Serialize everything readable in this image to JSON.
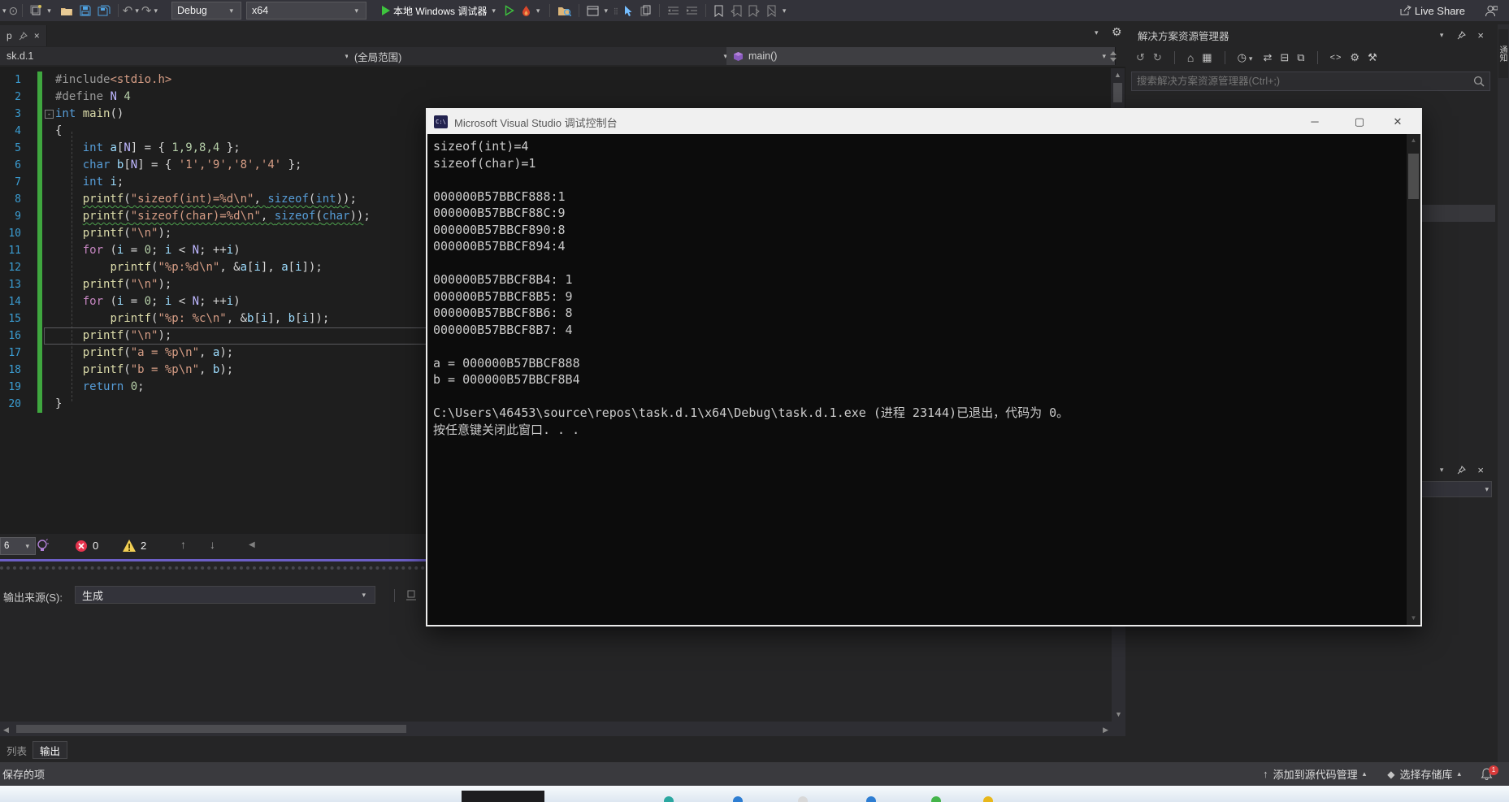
{
  "toolbar": {
    "debug_config": "Debug",
    "platform": "x64",
    "start_label": "本地 Windows 调试器",
    "live_share_label": "Live Share",
    "start_color": "#3EC43E",
    "accent_purple": "#6C5FC7"
  },
  "doc_tab": {
    "label": "p"
  },
  "navbar": {
    "file": "sk.d.1",
    "scope": "(全局范围)",
    "symbol": "main()"
  },
  "editor": {
    "lines": [
      {
        "n": 1,
        "segs": [
          {
            "c": "pp",
            "t": "#include"
          },
          {
            "c": "s2",
            "t": "<stdio.h>"
          }
        ]
      },
      {
        "n": 2,
        "segs": [
          {
            "c": "pp",
            "t": "#define "
          },
          {
            "c": "m",
            "t": "N"
          },
          {
            "c": "p",
            "t": " "
          },
          {
            "c": "n",
            "t": "4"
          }
        ]
      },
      {
        "n": 3,
        "fold": true,
        "segs": [
          {
            "c": "k",
            "t": "int"
          },
          {
            "c": "p",
            "t": " "
          },
          {
            "c": "f",
            "t": "main"
          },
          {
            "c": "p",
            "t": "()"
          }
        ]
      },
      {
        "n": 4,
        "segs": [
          {
            "c": "p",
            "t": "{"
          }
        ]
      },
      {
        "n": 5,
        "segs": [
          {
            "c": "p",
            "t": "    "
          },
          {
            "c": "k",
            "t": "int"
          },
          {
            "c": "p",
            "t": " "
          },
          {
            "c": "v",
            "t": "a"
          },
          {
            "c": "p",
            "t": "["
          },
          {
            "c": "m",
            "t": "N"
          },
          {
            "c": "p",
            "t": "] = { "
          },
          {
            "c": "n",
            "t": "1,9,8,4"
          },
          {
            "c": "p",
            "t": " };"
          }
        ]
      },
      {
        "n": 6,
        "segs": [
          {
            "c": "p",
            "t": "    "
          },
          {
            "c": "k",
            "t": "char"
          },
          {
            "c": "p",
            "t": " "
          },
          {
            "c": "v",
            "t": "b"
          },
          {
            "c": "p",
            "t": "["
          },
          {
            "c": "m",
            "t": "N"
          },
          {
            "c": "p",
            "t": "] = { "
          },
          {
            "c": "s",
            "t": "'1','9','8','4'"
          },
          {
            "c": "p",
            "t": " };"
          }
        ]
      },
      {
        "n": 7,
        "segs": [
          {
            "c": "p",
            "t": "    "
          },
          {
            "c": "k",
            "t": "int"
          },
          {
            "c": "p",
            "t": " "
          },
          {
            "c": "v",
            "t": "i"
          },
          {
            "c": "p",
            "t": ";"
          }
        ]
      },
      {
        "n": 8,
        "segs": [
          {
            "c": "p",
            "t": "    "
          },
          {
            "c": "f",
            "t": "printf",
            "u": 1
          },
          {
            "c": "p",
            "t": "(",
            "u": 1
          },
          {
            "c": "s",
            "t": "\"sizeof(int)=%d\\n\"",
            "u": 1
          },
          {
            "c": "p",
            "t": ", ",
            "u": 1
          },
          {
            "c": "k",
            "t": "sizeof",
            "u": 1
          },
          {
            "c": "p",
            "t": "(",
            "u": 1
          },
          {
            "c": "k",
            "t": "int",
            "u": 1
          },
          {
            "c": "p",
            "t": "))",
            "u": 1
          },
          {
            "c": "p",
            "t": ";"
          }
        ]
      },
      {
        "n": 9,
        "segs": [
          {
            "c": "p",
            "t": "    "
          },
          {
            "c": "f",
            "t": "printf",
            "u": 1
          },
          {
            "c": "p",
            "t": "(",
            "u": 1
          },
          {
            "c": "s",
            "t": "\"sizeof(char)=%d\\n\"",
            "u": 1
          },
          {
            "c": "p",
            "t": ", ",
            "u": 1
          },
          {
            "c": "k",
            "t": "sizeof",
            "u": 1
          },
          {
            "c": "p",
            "t": "(",
            "u": 1
          },
          {
            "c": "k",
            "t": "char",
            "u": 1
          },
          {
            "c": "p",
            "t": "))",
            "u": 1
          },
          {
            "c": "p",
            "t": ";"
          }
        ]
      },
      {
        "n": 10,
        "segs": [
          {
            "c": "p",
            "t": "    "
          },
          {
            "c": "f",
            "t": "printf"
          },
          {
            "c": "p",
            "t": "("
          },
          {
            "c": "s",
            "t": "\"\\n\""
          },
          {
            "c": "p",
            "t": ");"
          }
        ]
      },
      {
        "n": 11,
        "segs": [
          {
            "c": "p",
            "t": "    "
          },
          {
            "c": "c",
            "t": "for"
          },
          {
            "c": "p",
            "t": " ("
          },
          {
            "c": "v",
            "t": "i"
          },
          {
            "c": "p",
            "t": " = "
          },
          {
            "c": "n",
            "t": "0"
          },
          {
            "c": "p",
            "t": "; "
          },
          {
            "c": "v",
            "t": "i"
          },
          {
            "c": "p",
            "t": " < "
          },
          {
            "c": "m",
            "t": "N"
          },
          {
            "c": "p",
            "t": "; ++"
          },
          {
            "c": "v",
            "t": "i"
          },
          {
            "c": "p",
            "t": ")"
          }
        ]
      },
      {
        "n": 12,
        "segs": [
          {
            "c": "p",
            "t": "        "
          },
          {
            "c": "f",
            "t": "printf"
          },
          {
            "c": "p",
            "t": "("
          },
          {
            "c": "s",
            "t": "\"%p:%d\\n\""
          },
          {
            "c": "p",
            "t": ", &"
          },
          {
            "c": "v",
            "t": "a"
          },
          {
            "c": "p",
            "t": "["
          },
          {
            "c": "v",
            "t": "i"
          },
          {
            "c": "p",
            "t": "], "
          },
          {
            "c": "v",
            "t": "a"
          },
          {
            "c": "p",
            "t": "["
          },
          {
            "c": "v",
            "t": "i"
          },
          {
            "c": "p",
            "t": "]);"
          }
        ]
      },
      {
        "n": 13,
        "segs": [
          {
            "c": "p",
            "t": "    "
          },
          {
            "c": "f",
            "t": "printf"
          },
          {
            "c": "p",
            "t": "("
          },
          {
            "c": "s",
            "t": "\"\\n\""
          },
          {
            "c": "p",
            "t": ");"
          }
        ]
      },
      {
        "n": 14,
        "segs": [
          {
            "c": "p",
            "t": "    "
          },
          {
            "c": "c",
            "t": "for"
          },
          {
            "c": "p",
            "t": " ("
          },
          {
            "c": "v",
            "t": "i"
          },
          {
            "c": "p",
            "t": " = "
          },
          {
            "c": "n",
            "t": "0"
          },
          {
            "c": "p",
            "t": "; "
          },
          {
            "c": "v",
            "t": "i"
          },
          {
            "c": "p",
            "t": " < "
          },
          {
            "c": "m",
            "t": "N"
          },
          {
            "c": "p",
            "t": "; ++"
          },
          {
            "c": "v",
            "t": "i"
          },
          {
            "c": "p",
            "t": ")"
          }
        ]
      },
      {
        "n": 15,
        "segs": [
          {
            "c": "p",
            "t": "        "
          },
          {
            "c": "f",
            "t": "printf"
          },
          {
            "c": "p",
            "t": "("
          },
          {
            "c": "s",
            "t": "\"%p: %c\\n\""
          },
          {
            "c": "p",
            "t": ", &"
          },
          {
            "c": "v",
            "t": "b"
          },
          {
            "c": "p",
            "t": "["
          },
          {
            "c": "v",
            "t": "i"
          },
          {
            "c": "p",
            "t": "], "
          },
          {
            "c": "v",
            "t": "b"
          },
          {
            "c": "p",
            "t": "["
          },
          {
            "c": "v",
            "t": "i"
          },
          {
            "c": "p",
            "t": "]);"
          }
        ]
      },
      {
        "n": 16,
        "cur": true,
        "segs": [
          {
            "c": "p",
            "t": "    "
          },
          {
            "c": "f",
            "t": "printf"
          },
          {
            "c": "p",
            "t": "("
          },
          {
            "c": "s",
            "t": "\"\\n\""
          },
          {
            "c": "p",
            "t": ");"
          }
        ]
      },
      {
        "n": 17,
        "segs": [
          {
            "c": "p",
            "t": "    "
          },
          {
            "c": "f",
            "t": "printf"
          },
          {
            "c": "p",
            "t": "("
          },
          {
            "c": "s",
            "t": "\"a = %p\\n\""
          },
          {
            "c": "p",
            "t": ", "
          },
          {
            "c": "v",
            "t": "a"
          },
          {
            "c": "p",
            "t": ");"
          }
        ]
      },
      {
        "n": 18,
        "segs": [
          {
            "c": "p",
            "t": "    "
          },
          {
            "c": "f",
            "t": "printf"
          },
          {
            "c": "p",
            "t": "("
          },
          {
            "c": "s",
            "t": "\"b = %p\\n\""
          },
          {
            "c": "p",
            "t": ", "
          },
          {
            "c": "v",
            "t": "b"
          },
          {
            "c": "p",
            "t": ");"
          }
        ]
      },
      {
        "n": 19,
        "segs": [
          {
            "c": "p",
            "t": "    "
          },
          {
            "c": "k",
            "t": "return"
          },
          {
            "c": "p",
            "t": " "
          },
          {
            "c": "n",
            "t": "0"
          },
          {
            "c": "p",
            "t": ";"
          }
        ]
      },
      {
        "n": 20,
        "segs": [
          {
            "c": "p",
            "t": "}"
          }
        ]
      }
    ]
  },
  "console": {
    "icon_label": "C:\\",
    "title": "Microsoft Visual Studio 调试控制台",
    "lines": [
      "sizeof(int)=4",
      "sizeof(char)=1",
      "",
      "000000B57BBCF888:1",
      "000000B57BBCF88C:9",
      "000000B57BBCF890:8",
      "000000B57BBCF894:4",
      "",
      "000000B57BBCF8B4: 1",
      "000000B57BBCF8B5: 9",
      "000000B57BBCF8B6: 8",
      "000000B57BBCF8B7: 4",
      "",
      "a = 000000B57BBCF888",
      "b = 000000B57BBCF8B4",
      "",
      "C:\\Users\\46453\\source\\repos\\task.d.1\\x64\\Debug\\task.d.1.exe (进程 23144)已退出，代码为 0。",
      "按任意键关闭此窗口. . ."
    ]
  },
  "solution_explorer": {
    "title": "解决方案资源管理器",
    "search_placeholder": "搜索解决方案资源管理器(Ctrl+;)"
  },
  "right_edge": {
    "tab_label": "通知"
  },
  "error_bar": {
    "filter_value": "6",
    "errors": "0",
    "warnings": "2"
  },
  "output": {
    "source_label": "输出来源(S):",
    "source_value": "生成"
  },
  "panel_tabs": {
    "list": "列表",
    "output": "输出"
  },
  "status_bar": {
    "left": "保存的项",
    "add_source_control": "添加到源代码管理",
    "select_repo": "选择存储库",
    "notification_count": "1"
  }
}
